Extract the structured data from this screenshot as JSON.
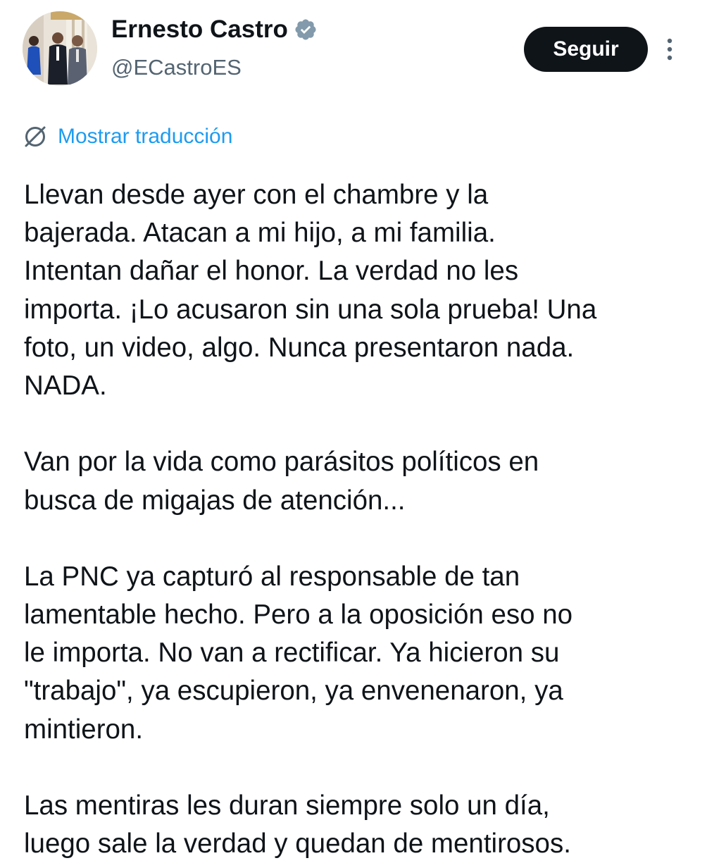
{
  "author": {
    "display_name": "Ernesto Castro",
    "handle": "@ECastroES",
    "verified_icon": "verified-badge-gray",
    "avatar_icon": "profile-photo"
  },
  "actions": {
    "follow_label": "Seguir",
    "more_icon": "vertical-ellipsis"
  },
  "translation": {
    "label": "Mostrar traducción",
    "icon": "globe-slash-icon"
  },
  "tweet": {
    "paragraphs": [
      {
        "lines": [
          "Llevan desde ayer con el chambre y la",
          "bajerada. Atacan a mi hijo, a mi familia.",
          "Intentan dañar el honor. La verdad no les",
          "importa. ¡Lo acusaron sin una sola prueba! Una",
          "foto, un video, algo. Nunca presentaron nada.",
          "NADA."
        ]
      },
      {
        "lines": [
          "Van por la vida como parásitos políticos en",
          "busca de migajas de atención..."
        ]
      },
      {
        "lines": [
          "La PNC ya capturó al responsable de tan",
          "lamentable hecho. Pero a la oposición eso no",
          "le importa. No van a rectificar. Ya hicieron su",
          "\"trabajo\", ya escupieron, ya envenenaron, ya",
          "mintieron."
        ]
      },
      {
        "lines": [
          "Las mentiras les duran siempre solo un día,",
          "luego sale la verdad y quedan de mentirosos."
        ]
      }
    ]
  },
  "colors": {
    "text": "#0f1419",
    "secondary_text": "#536471",
    "link": "#1d9bf0",
    "button_bg": "#0f1419",
    "button_text": "#ffffff",
    "verified_badge": "#829aab"
  }
}
